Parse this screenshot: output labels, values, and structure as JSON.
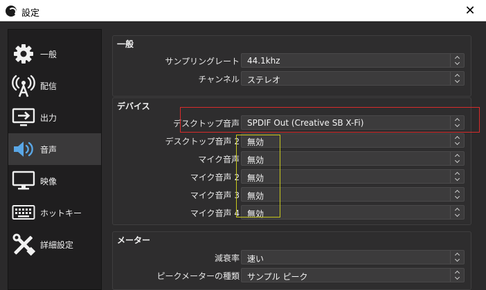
{
  "window": {
    "title": "設定",
    "close_glyph": "✕"
  },
  "sidebar": {
    "items": [
      {
        "label": "一般",
        "icon": "gear-icon"
      },
      {
        "label": "配信",
        "icon": "broadcast-icon"
      },
      {
        "label": "出力",
        "icon": "output-icon"
      },
      {
        "label": "音声",
        "icon": "speaker-icon",
        "active": true
      },
      {
        "label": "映像",
        "icon": "monitor-icon"
      },
      {
        "label": "ホットキー",
        "icon": "keyboard-icon"
      },
      {
        "label": "詳細設定",
        "icon": "tools-icon"
      }
    ]
  },
  "general": {
    "title": "一般",
    "sample_rate": {
      "label": "サンプリングレート",
      "value": "44.1khz"
    },
    "channels": {
      "label": "チャンネル",
      "value": "ステレオ"
    }
  },
  "devices": {
    "title": "デバイス",
    "rows": [
      {
        "label": "デスクトップ音声",
        "value": "SPDIF Out (Creative SB X-Fi)"
      },
      {
        "label": "デスクトップ音声 2",
        "value": "無効"
      },
      {
        "label": "マイク音声",
        "value": "無効"
      },
      {
        "label": "マイク音声 2",
        "value": "無効"
      },
      {
        "label": "マイク音声 3",
        "value": "無効"
      },
      {
        "label": "マイク音声 4",
        "value": "無効"
      }
    ]
  },
  "meters": {
    "title": "メーター",
    "decay": {
      "label": "減衰率",
      "value": "速い"
    },
    "peak_type": {
      "label": "ピークメーターの種類",
      "value": "サンプル ピーク"
    }
  },
  "colors": {
    "annotation_red": "#d92b2b",
    "annotation_yellow": "#c8c81c"
  }
}
